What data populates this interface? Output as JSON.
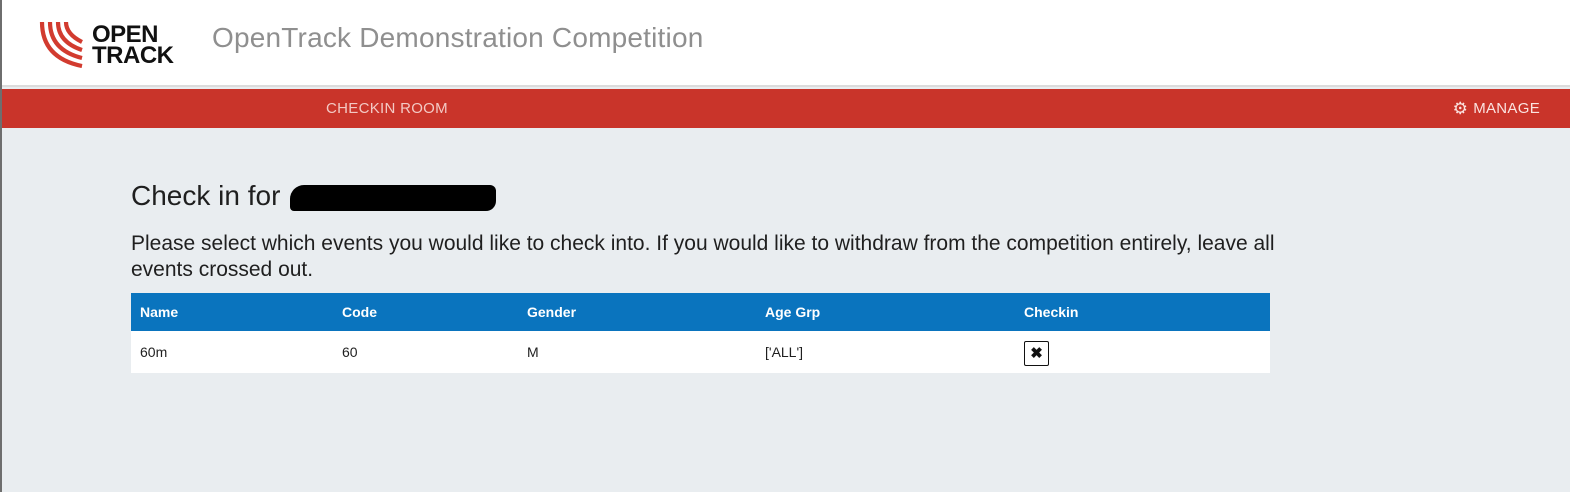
{
  "header": {
    "logo_line1": "OPEN",
    "logo_line2": "TRACK",
    "title": "OpenTrack Demonstration Competition"
  },
  "nav": {
    "checkin_room": "CHECKIN ROOM",
    "manage": "MANAGE"
  },
  "page": {
    "heading": "Check in for",
    "instructions": "Please select which events you would like to check into. If you would like to withdraw from the competition entirely, leave all events crossed out."
  },
  "table": {
    "columns": [
      "Name",
      "Code",
      "Gender",
      "Age Grp",
      "Checkin"
    ],
    "rows": [
      {
        "name": "60m",
        "code": "60",
        "gender": "M",
        "age_grp": "['ALL']",
        "checkin_symbol": "✖"
      }
    ]
  },
  "colors": {
    "nav_bar": "#c9342a",
    "table_header": "#0a74be",
    "page_bg": "#e9edf0"
  },
  "icons": {
    "manage": "gear-icon",
    "checkin": "close-icon"
  }
}
